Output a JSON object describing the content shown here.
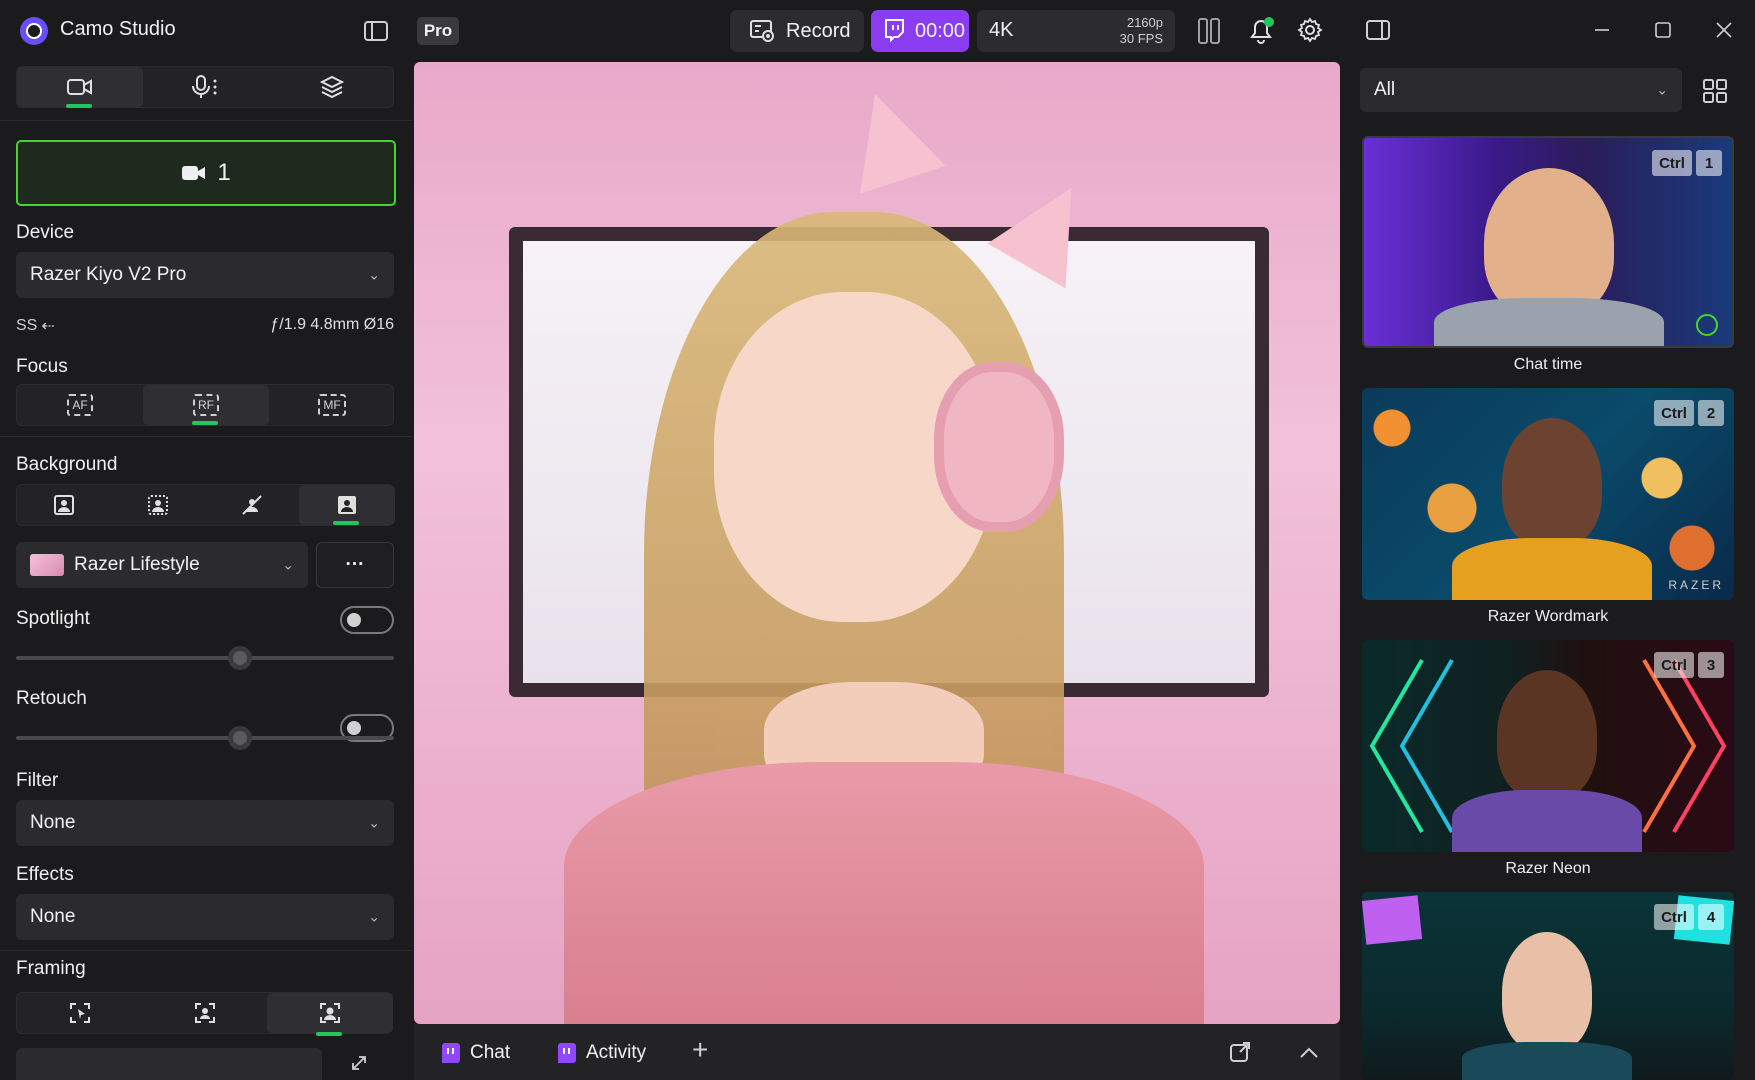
{
  "app": {
    "title": "Camo Studio",
    "pro_badge": "Pro"
  },
  "toolbar": {
    "record_label": "Record",
    "stream_time": "00:00",
    "resolution": "4K",
    "resolution_detail": "2160p",
    "fps": "30 FPS"
  },
  "left": {
    "tabs": [
      {
        "name": "video",
        "icon": "video-camera-icon",
        "active": true
      },
      {
        "name": "audio",
        "icon": "microphone-icon",
        "active": false
      },
      {
        "name": "layers",
        "icon": "layers-icon",
        "active": false
      }
    ],
    "camera_number": "1",
    "device": {
      "label": "Device",
      "value": "Razer Kiyo V2 Pro",
      "connection": "SS",
      "lens": "ƒ/1.9 4.8mm Ø16"
    },
    "focus": {
      "label": "Focus",
      "modes": [
        "AF",
        "RF",
        "MF"
      ],
      "active_index": 1
    },
    "background": {
      "label": "Background",
      "active_index": 3,
      "preset": "Razer Lifestyle",
      "more": "···"
    },
    "spotlight": {
      "label": "Spotlight",
      "enabled": false,
      "level": 0.59
    },
    "retouch": {
      "label": "Retouch",
      "enabled": false,
      "level": 0.59
    },
    "filter": {
      "label": "Filter",
      "value": "None"
    },
    "effects": {
      "label": "Effects",
      "value": "None"
    },
    "framing": {
      "label": "Framing",
      "active_index": 2
    }
  },
  "bottom": {
    "chat_label": "Chat",
    "activity_label": "Activity",
    "add": "+"
  },
  "right": {
    "filter_value": "All",
    "scenes": [
      {
        "name": "Chat time",
        "ctrl": "Ctrl",
        "key": "1"
      },
      {
        "name": "Razer Wordmark",
        "ctrl": "Ctrl",
        "key": "2"
      },
      {
        "name": "Razer Neon",
        "ctrl": "Ctrl",
        "key": "3"
      },
      {
        "name": "",
        "ctrl": "Ctrl",
        "key": "4"
      }
    ],
    "wordmark": "RAZER"
  }
}
